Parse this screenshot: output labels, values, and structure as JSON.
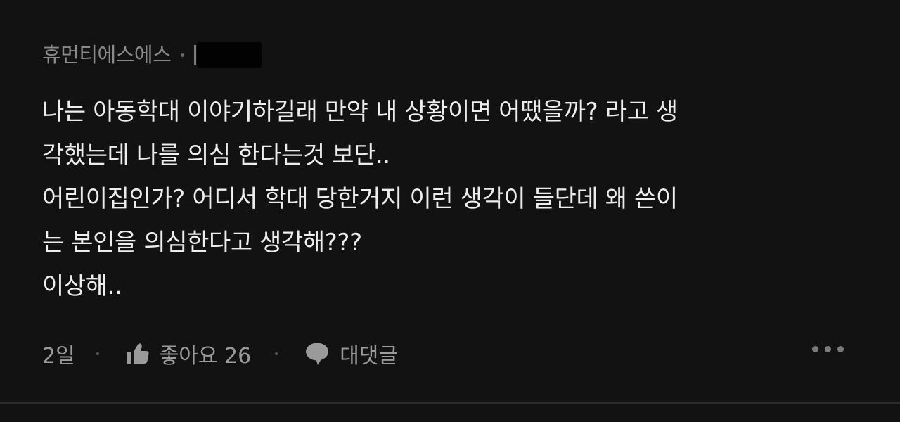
{
  "comment": {
    "author": "휴먼티에스에스",
    "body_lines": [
      "나는 아동학대 이야기하길래 만약 내 상황이면 어땠을까? 라고 생",
      "각했는데 나를 의심 한다는것 보단..",
      "어린이집인가? 어디서 학대 당한거지 이런 생각이 들단데 왜 쓴이",
      "는 본인을 의심한다고 생각해???",
      "이상해.."
    ],
    "time": "2일",
    "like_label": "좋아요 26",
    "reply_label": "대댓글"
  },
  "colors": {
    "background": "#121212",
    "body_text": "#ededed",
    "muted_text": "#8a8a8a"
  },
  "icons": {
    "like": "thumbs-up-icon",
    "reply": "speech-bubble-icon",
    "more": "more-horizontal-icon"
  }
}
